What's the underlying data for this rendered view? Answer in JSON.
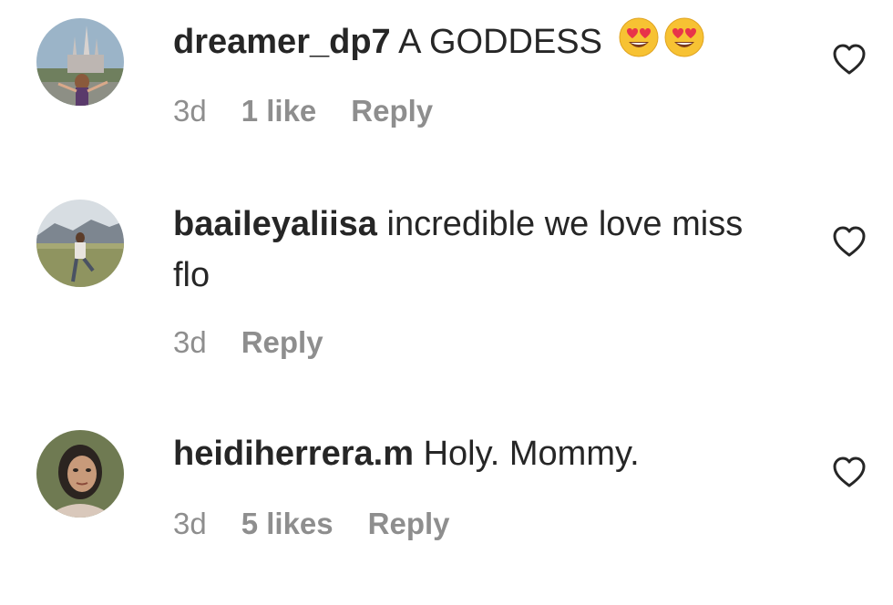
{
  "comments": [
    {
      "username": "dreamer_dp7",
      "text": "A GODDESS",
      "emoji": [
        "heart-eyes-emoji",
        "heart-eyes-emoji"
      ],
      "time": "3d",
      "likes": "1 like",
      "reply": "Reply"
    },
    {
      "username": "baaileyaliisa",
      "text": "incredible we love miss flo",
      "time": "3d",
      "reply": "Reply"
    },
    {
      "username": "heidiherrera.m",
      "text": "Holy. Mommy.",
      "time": "3d",
      "likes": "5 likes",
      "reply": "Reply"
    }
  ],
  "colors": {
    "text": "#262626",
    "meta": "#8e8e8e",
    "background": "#ffffff"
  },
  "icons": {
    "like": "heart-outline-icon"
  }
}
